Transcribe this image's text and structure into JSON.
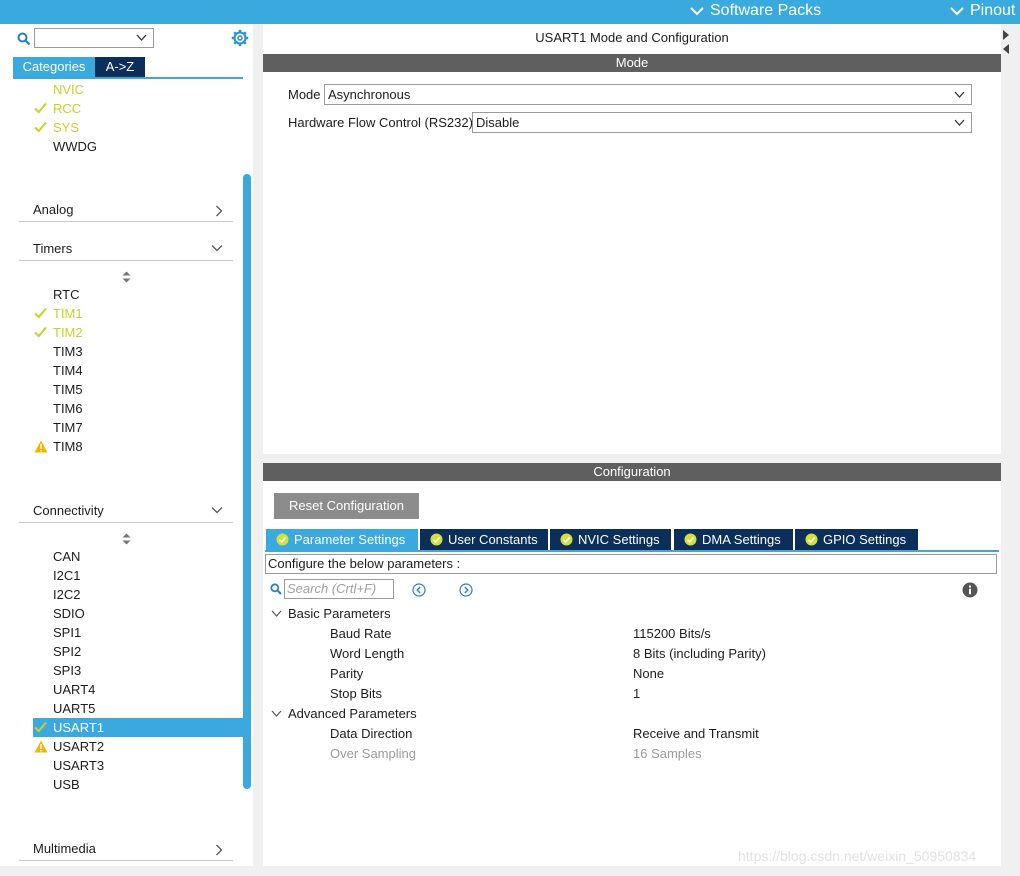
{
  "topbar": {
    "software_packs": "Software Packs",
    "pinout": "Pinout"
  },
  "sidebar": {
    "tabs": {
      "categories": "Categories",
      "az": "A->Z"
    },
    "system_items": [
      {
        "label": "NVIC",
        "status": "ok-nocheck"
      },
      {
        "label": "RCC",
        "status": "ok"
      },
      {
        "label": "SYS",
        "status": "ok"
      },
      {
        "label": "WWDG",
        "status": "none"
      }
    ],
    "categories": {
      "analog": "Analog",
      "timers": "Timers",
      "connectivity": "Connectivity",
      "multimedia": "Multimedia"
    },
    "timer_items": [
      {
        "label": "RTC",
        "status": "none"
      },
      {
        "label": "TIM1",
        "status": "ok"
      },
      {
        "label": "TIM2",
        "status": "ok"
      },
      {
        "label": "TIM3",
        "status": "none"
      },
      {
        "label": "TIM4",
        "status": "none"
      },
      {
        "label": "TIM5",
        "status": "none"
      },
      {
        "label": "TIM6",
        "status": "none"
      },
      {
        "label": "TIM7",
        "status": "none"
      },
      {
        "label": "TIM8",
        "status": "warning"
      }
    ],
    "connectivity_items": [
      {
        "label": "CAN",
        "status": "none"
      },
      {
        "label": "I2C1",
        "status": "none"
      },
      {
        "label": "I2C2",
        "status": "none"
      },
      {
        "label": "SDIO",
        "status": "none"
      },
      {
        "label": "SPI1",
        "status": "none"
      },
      {
        "label": "SPI2",
        "status": "none"
      },
      {
        "label": "SPI3",
        "status": "none"
      },
      {
        "label": "UART4",
        "status": "none"
      },
      {
        "label": "UART5",
        "status": "none"
      },
      {
        "label": "USART1",
        "status": "selected"
      },
      {
        "label": "USART2",
        "status": "warning"
      },
      {
        "label": "USART3",
        "status": "none"
      },
      {
        "label": "USB",
        "status": "none"
      }
    ]
  },
  "main": {
    "title": "USART1 Mode and Configuration",
    "mode_section": "Mode",
    "mode_label": "Mode",
    "mode_value": "Asynchronous",
    "flow_label": "Hardware Flow Control (RS232)",
    "flow_value": "Disable"
  },
  "config": {
    "section": "Configuration",
    "reset_button": "Reset Configuration",
    "tabs": [
      "Parameter Settings",
      "User Constants",
      "NVIC Settings",
      "DMA Settings",
      "GPIO Settings"
    ],
    "describe": "Configure the below parameters :",
    "search_placeholder": "Search (Crtl+F)",
    "groups": {
      "basic": "Basic Parameters",
      "advanced": "Advanced Parameters"
    },
    "basic_params": [
      {
        "name": "Baud Rate",
        "value": "115200 Bits/s"
      },
      {
        "name": "Word Length",
        "value": "8 Bits (including Parity)"
      },
      {
        "name": "Parity",
        "value": "None"
      },
      {
        "name": "Stop Bits",
        "value": "1"
      }
    ],
    "advanced_params": [
      {
        "name": "Data Direction",
        "value": "Receive and Transmit"
      },
      {
        "name": "Over Sampling",
        "value": "16 Samples"
      }
    ]
  },
  "watermark": "https://blog.csdn.net/weixin_50950834",
  "colors": {
    "accent": "#3aa9de",
    "dark_tab": "#0b2e5a",
    "ok": "#c6d12a",
    "warning": "#f2b600",
    "section_bar": "#5f5f5f"
  }
}
